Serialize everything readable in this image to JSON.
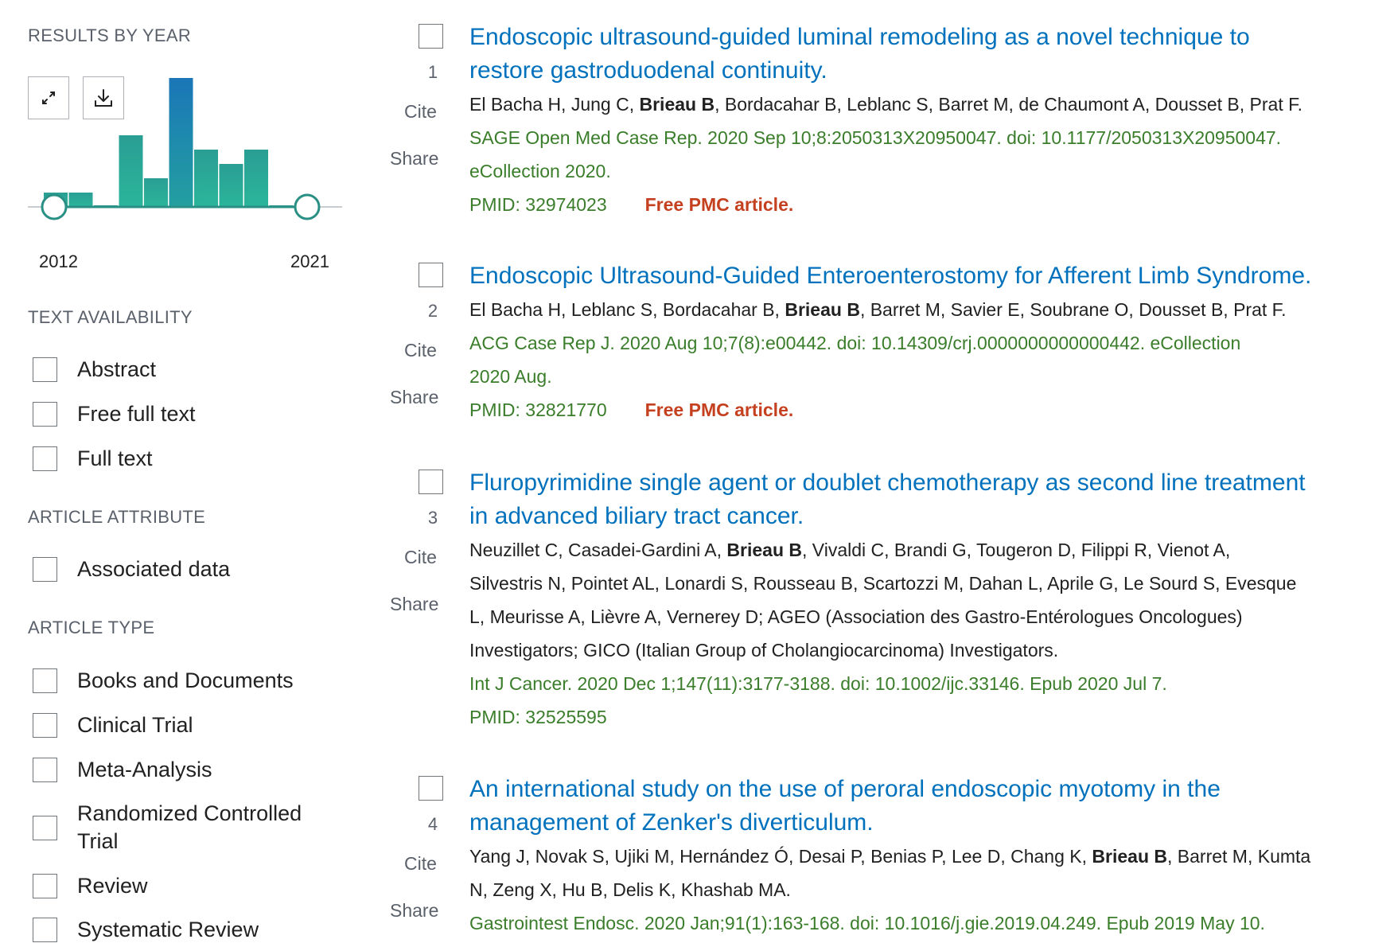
{
  "sidebar": {
    "results_by_year": {
      "title": "RESULTS BY YEAR",
      "expand_icon": "expand-icon",
      "download_icon": "download-icon",
      "start_year": "2012",
      "end_year": "2021"
    },
    "text_availability": {
      "title": "TEXT AVAILABILITY",
      "items": [
        "Abstract",
        "Free full text",
        "Full text"
      ]
    },
    "article_attribute": {
      "title": "ARTICLE ATTRIBUTE",
      "items": [
        "Associated data"
      ]
    },
    "article_type": {
      "title": "ARTICLE TYPE",
      "items": [
        "Books and Documents",
        "Clinical Trial",
        "Meta-Analysis",
        "Randomized Controlled",
        "Trial",
        "Review",
        "Systematic Review"
      ]
    }
  },
  "chart_data": {
    "type": "bar",
    "categories": [
      "2012",
      "2013",
      "2014",
      "2015",
      "2016",
      "2017",
      "2018",
      "2019",
      "2020",
      "2021"
    ],
    "values": [
      1,
      1,
      0,
      5,
      2,
      9,
      4,
      3,
      4,
      0
    ],
    "x_range": [
      "2012",
      "2021"
    ],
    "highlighted": "2017",
    "colors": {
      "bar_top": "#2a9e94",
      "bar_bottom": "#2bb59b",
      "highlight_top": "#1a76b8",
      "highlight_bottom": "#23a0a0",
      "slider": "#2a8f84"
    }
  },
  "results": [
    {
      "number": "1",
      "title_lines": [
        "Endoscopic ultrasound-guided luminal remodeling as a novel technique to",
        "restore gastroduodenal continuity."
      ],
      "authors_lines": [
        {
          "pre": "El Bacha H, Jung C, ",
          "bold": "Brieau B",
          "post": ", Bordacahar B, Leblanc S, Barret M, de Chaumont A, Dousset B, Prat F."
        }
      ],
      "citation_lines": [
        "SAGE Open Med Case Rep. 2020 Sep 10;8:2050313X20950047. doi: 10.1177/2050313X20950047.",
        "eCollection 2020."
      ],
      "pmid": "PMID: 32974023",
      "free": "Free PMC article.",
      "cite": "Cite",
      "share": "Share"
    },
    {
      "number": "2",
      "title_lines": [
        "Endoscopic Ultrasound-Guided Enteroenterostomy for Afferent Limb Syndrome."
      ],
      "authors_lines": [
        {
          "pre": "El Bacha H, Leblanc S, Bordacahar B, ",
          "bold": "Brieau B",
          "post": ", Barret M, Savier E, Soubrane O, Dousset B, Prat F."
        }
      ],
      "citation_lines": [
        "ACG Case Rep J. 2020 Aug 10;7(8):e00442. doi: 10.14309/crj.0000000000000442. eCollection",
        "2020 Aug."
      ],
      "pmid": "PMID: 32821770",
      "free": "Free PMC article.",
      "cite": "Cite",
      "share": "Share"
    },
    {
      "number": "3",
      "title_lines": [
        "Fluropyrimidine single agent or doublet chemotherapy as second line treatment",
        "in advanced biliary tract cancer."
      ],
      "authors_lines": [
        {
          "pre": "Neuzillet C, Casadei-Gardini A, ",
          "bold": "Brieau B",
          "post": ", Vivaldi C, Brandi G, Tougeron D, Filippi R, Vienot A,"
        },
        {
          "pre": "Silvestris N, Pointet AL, Lonardi S, Rousseau B, Scartozzi M, Dahan L, Aprile G, Le Sourd S, Evesque",
          "bold": "",
          "post": ""
        },
        {
          "pre": "L, Meurisse A, Lièvre A, Vernerey D; AGEO (Association des Gastro-Entérologues Oncologues)",
          "bold": "",
          "post": ""
        },
        {
          "pre": "Investigators; GICO (Italian Group of Cholangiocarcinoma) Investigators.",
          "bold": "",
          "post": ""
        }
      ],
      "citation_lines": [
        "Int J Cancer. 2020 Dec 1;147(11):3177-3188. doi: 10.1002/ijc.33146. Epub 2020 Jul 7."
      ],
      "pmid": "PMID: 32525595",
      "free": "",
      "cite": "Cite",
      "share": "Share"
    },
    {
      "number": "4",
      "title_lines": [
        "An international study on the use of peroral endoscopic myotomy in the",
        "management of Zenker's diverticulum."
      ],
      "authors_lines": [
        {
          "pre": "Yang J, Novak S, Ujiki M, Hernández Ó, Desai P, Benias P, Lee D, Chang K, ",
          "bold": "Brieau B",
          "post": ", Barret M, Kumta"
        },
        {
          "pre": "N, Zeng X, Hu B, Delis K, Khashab MA.",
          "bold": "",
          "post": ""
        }
      ],
      "citation_lines": [
        "Gastrointest Endosc. 2020 Jan;91(1):163-168. doi: 10.1016/j.gie.2019.04.249. Epub 2019 May 10."
      ],
      "pmid": "",
      "free": "",
      "cite": "Cite",
      "share": "Share"
    }
  ]
}
